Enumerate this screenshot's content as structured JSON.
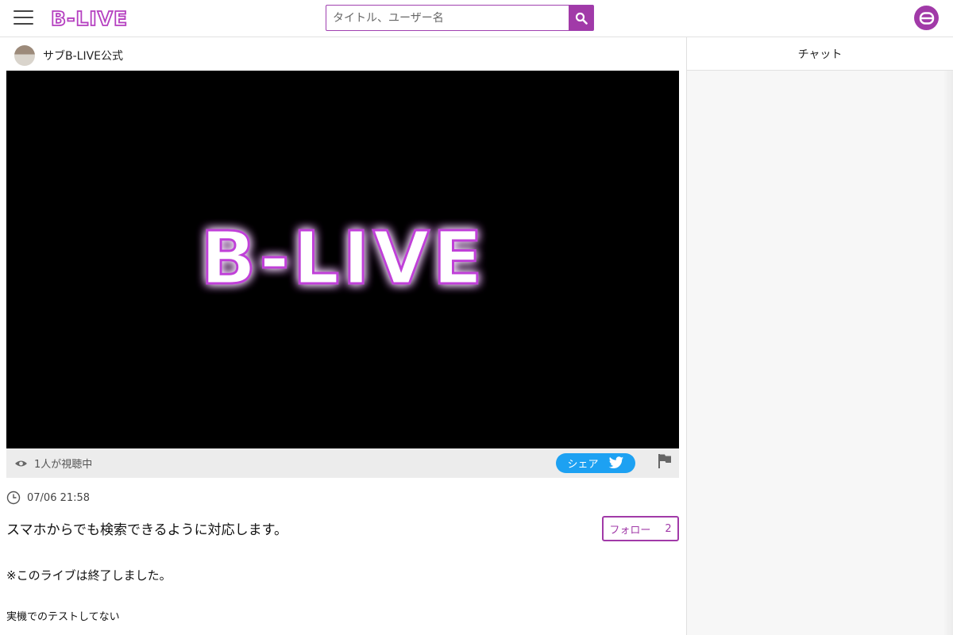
{
  "header": {
    "logo_text": "B-LIVE",
    "search_placeholder": "タイトル、ユーザー名",
    "icons": [
      "menu-icon",
      "search-icon",
      "user-icon"
    ]
  },
  "channel": {
    "name": "サブB-LIVE公式"
  },
  "video": {
    "overlay_logo": "B-LIVE"
  },
  "video_bar": {
    "viewers": "1人が視聴中",
    "share_label": "シェア",
    "icons": [
      "eye-icon",
      "twitter-icon",
      "flag-icon"
    ]
  },
  "stream": {
    "time": "07/06 21:58",
    "title": "スマホからでも検索できるように対応します。",
    "follow_label": "フォロー",
    "follow_count": "2",
    "ended_notice": "※このライブは終了しました。",
    "description": "実機でのテストしてない"
  },
  "chat": {
    "title": "チャット"
  },
  "colors": {
    "brand": "#a13aa8",
    "twitter": "#1da1f2",
    "video_bg": "#000000"
  }
}
